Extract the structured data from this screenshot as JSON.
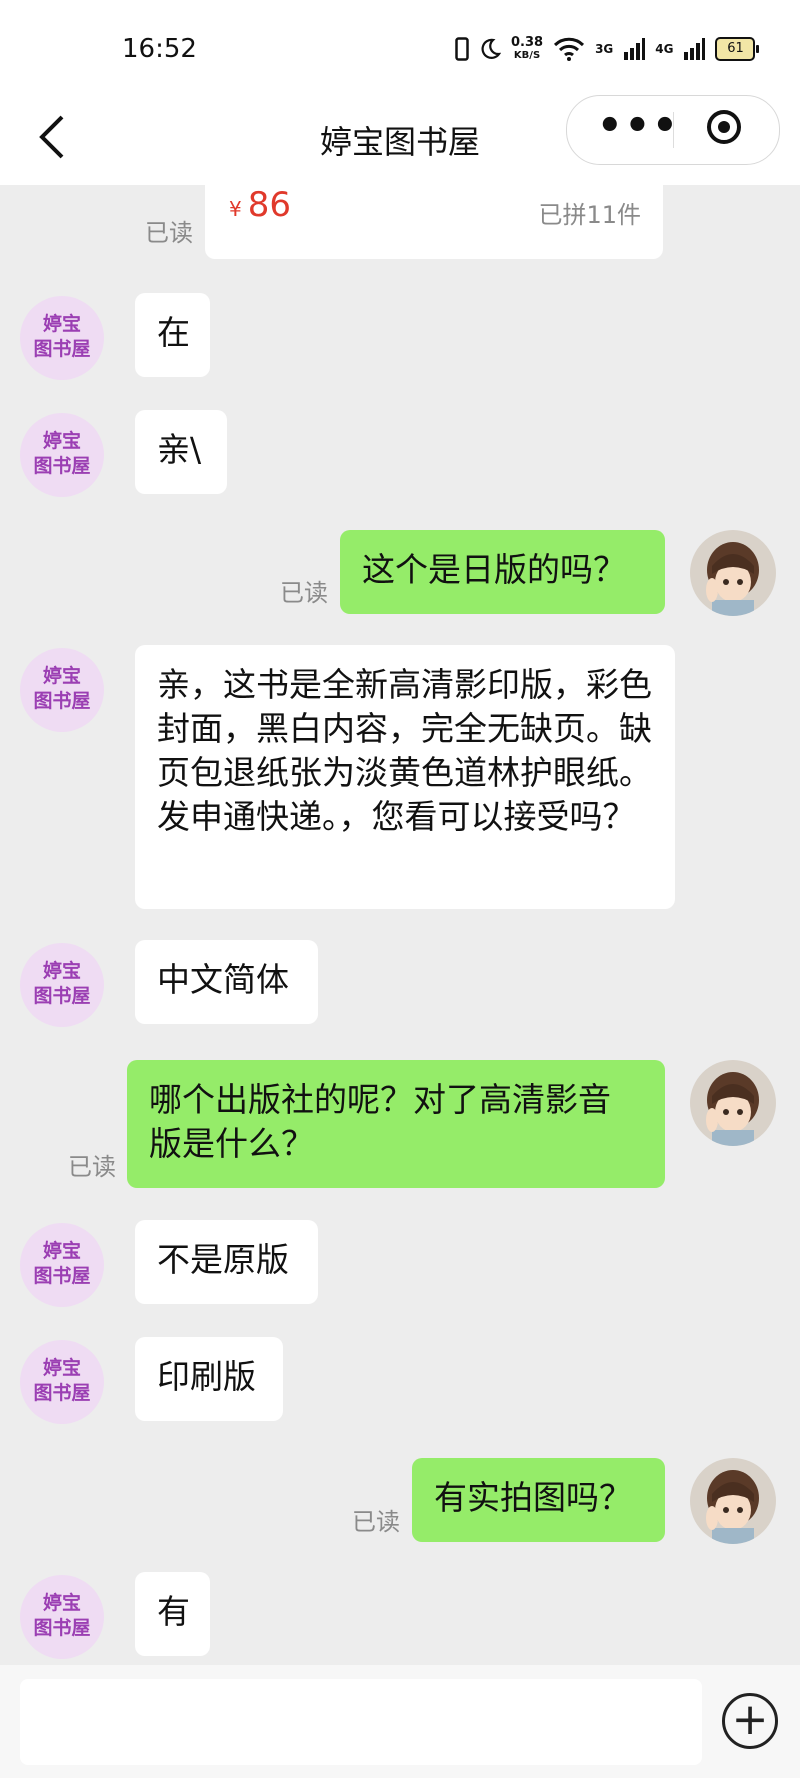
{
  "status_bar": {
    "time": "16:52",
    "net_speed_value": "0.38",
    "net_speed_unit": "KB/S",
    "net_3g": "3G",
    "net_4g": "4G",
    "battery": "61"
  },
  "nav": {
    "back_icon": "chevron-left-icon",
    "title": "婷宝图书屋",
    "more_icon": "more-dots-icon",
    "target_icon": "target-icon"
  },
  "chat": {
    "product_card": {
      "currency": "¥",
      "price": "86",
      "sold": "已拼11件",
      "read": "已读"
    },
    "shop_avatar": {
      "line1": "婷宝",
      "line2": "图书屋"
    },
    "messages": [
      {
        "side": "in",
        "text": "在"
      },
      {
        "side": "in",
        "text": "亲\\"
      },
      {
        "side": "out",
        "text": "这个是日版的吗？",
        "read": "已读"
      },
      {
        "side": "in",
        "text": "亲，这书是全新高清影印版，彩色封面，黑白内容，完全无缺页。缺页包退纸张为淡黄色道林护眼纸。发申通快递。，您看可以接受吗？"
      },
      {
        "side": "in",
        "text": "中文简体"
      },
      {
        "side": "out",
        "text": "哪个出版社的呢？对了高清影音版是什么？",
        "read": "已读"
      },
      {
        "side": "in",
        "text": "不是原版"
      },
      {
        "side": "in",
        "text": "印刷版"
      },
      {
        "side": "out",
        "text": "有实拍图吗？",
        "read": "已读"
      },
      {
        "side": "in",
        "text": "有"
      }
    ]
  },
  "input_bar": {
    "plus_icon": "plus-circle-icon",
    "plus_glyph": "+"
  },
  "colors": {
    "outgoing_bubble": "#95ec69",
    "incoming_bubble": "#ffffff",
    "price": "#e0392b",
    "shop_avatar_text": "#9b3fb3"
  }
}
